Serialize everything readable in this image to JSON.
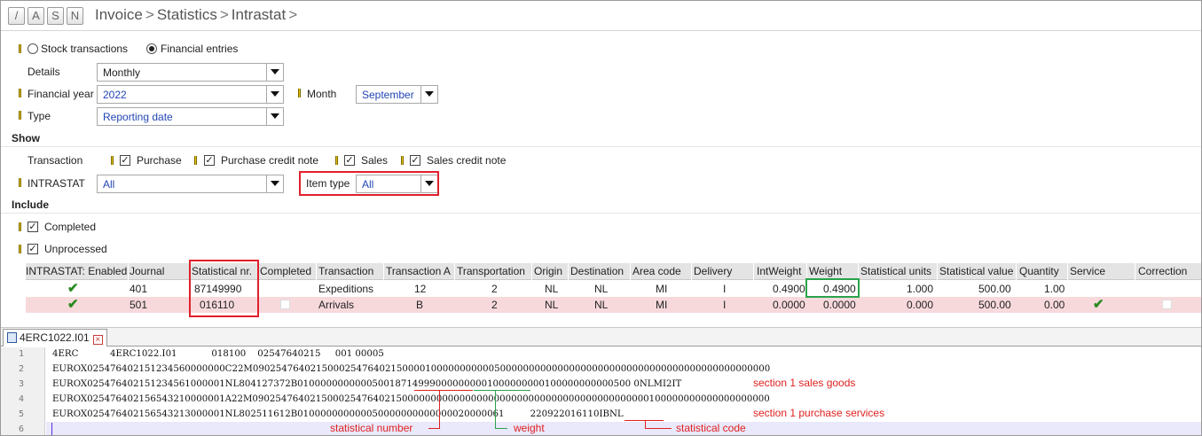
{
  "header": {
    "buttons": [
      "/",
      "A",
      "S",
      "N"
    ],
    "breadcrumb": [
      "Invoice",
      "Statistics",
      "Intrastat"
    ]
  },
  "filters": {
    "radio_stock": "Stock transactions",
    "radio_financial": "Financial entries",
    "details_label": "Details",
    "details_value": "Monthly",
    "year_label": "Financial year",
    "year_value": "2022",
    "month_label": "Month",
    "month_value": "September",
    "type_label": "Type",
    "type_value": "Reporting date"
  },
  "show": {
    "section": "Show",
    "transaction_label": "Transaction",
    "purchase": "Purchase",
    "purchase_credit": "Purchase credit note",
    "sales": "Sales",
    "sales_credit": "Sales credit note",
    "intrastat_label": "INTRASTAT",
    "intrastat_value": "All",
    "item_type_label": "Item type",
    "item_type_value": "All"
  },
  "include": {
    "section": "Include",
    "completed": "Completed",
    "unprocessed": "Unprocessed"
  },
  "grid": {
    "columns": [
      "INTRASTAT: Enabled",
      "Journal",
      "Statistical nr.",
      "Completed",
      "Transaction",
      "Transaction A",
      "Transportation",
      "Origin",
      "Destination",
      "Area code",
      "Delivery",
      "IntWeight",
      "Weight",
      "Statistical units",
      "Statistical value",
      "Quantity",
      "Service",
      "Correction"
    ],
    "rows": [
      {
        "journal": "401",
        "stat_nr": "87149990",
        "transaction": "Expeditions",
        "transaction_a": "12",
        "transportation": "2",
        "origin": "NL",
        "destination": "NL",
        "area": "MI",
        "delivery": "I",
        "intweight": "0.4900",
        "weight": "0.4900",
        "units": "1.000",
        "value": "500.00",
        "quantity": "1.00"
      },
      {
        "journal": "501",
        "stat_nr": "016110",
        "transaction": "Arrivals",
        "transaction_a": "B",
        "transportation": "2",
        "origin": "NL",
        "destination": "NL",
        "area": "MI",
        "delivery": "I",
        "intweight": "0.0000",
        "weight": "0.0000",
        "units": "0.000",
        "value": "500.00",
        "quantity": "0.00"
      }
    ]
  },
  "file_tab": {
    "name": "4ERC1022.I01"
  },
  "editor": {
    "line_numbers": [
      "1",
      "2",
      "3",
      "4",
      "5",
      "6"
    ],
    "lines": [
      "4ERC           4ERC1022.I01            018100    02547640215     001 00005",
      "EUROX025476402151234560000000C22M090254764021500025476402150000100000000000500000000000000000000000000000000000000000000000",
      "EUROX025476402151234561000001NL804127372B0100000000000500187149990000000001000000000100000000000500 0NLMI2IT",
      "EUROX025476402156543210000001A22M090254764021500025476402150000000000000000000000000000000000000000000100000000000000000000",
      "EUROX025476402156543213000001NL802511612B010000000000050000000000000020000061         220922016110IBNL",
      ""
    ],
    "annotations": {
      "sales": "section 1 sales goods",
      "purchase": "section 1 purchase services",
      "stat_number": "statistical number",
      "weight": "weight",
      "stat_code": "statistical code"
    }
  }
}
